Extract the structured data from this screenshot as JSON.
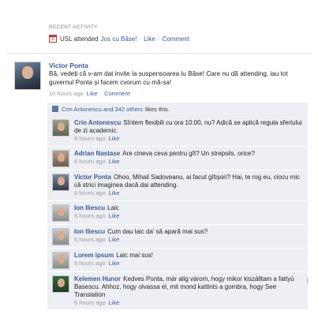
{
  "recent_activity": {
    "header": "RECENT ACTIVITY",
    "text": "USL attended",
    "event": "Jos cu Băse!",
    "like": "Like",
    "comment": "Comment"
  },
  "post": {
    "author": "Victor Ponta",
    "text": "Bă, vedeți că v-am dat invite la suspensoarea lu Băse! Care nu dă attending, iau tot guvernul Ponta și facem cvorum cu mă-sa!",
    "time": "10 hours ago",
    "like": "Like",
    "comment": "Comment"
  },
  "likes": {
    "names": "Crin Antonescu and 342 others",
    "suffix": "likes this."
  },
  "comments": [
    {
      "author": "Crin Antonescu",
      "text": "Sîntem flexibili cu ora 10:00, nu? Adică se aplică regula sfertului de zi academic.",
      "time": "8 hours ago",
      "like": "Like"
    },
    {
      "author": "Adrian Nastase",
      "text": "Are cineva ceva pentru gît? Un strepsils, orice?",
      "time": "6 hours ago",
      "like": "Like"
    },
    {
      "author": "Victor Ponta",
      "text": "Ohoo, Mihail Sadoveanu, ai facut gîtișori? Hai, te rog eu, ciocu mic că strici imaginea dacă dai attending.",
      "time": "6 hours ago",
      "like": "Like"
    },
    {
      "author": "Ion Iliescu",
      "text": "Laic",
      "time": "6 hours ago",
      "like": "Like"
    },
    {
      "author": "Ion Iliescu",
      "text": "Cum dau laic da' să apară mai sus?",
      "time": "6 hours ago",
      "like": "Like"
    },
    {
      "author": "Lorem ipsum",
      "text": "Laic mai sus!",
      "time": "6 hours ago",
      "like": "Like"
    },
    {
      "author": "Kelemen Hunor",
      "text": "Kedves Ponta, már alig várom, hogy mikor kiszálltam a fattyú Basescu. Ahhoz, hogy olvassa el, mit mond kattints a gombra, hogy See Translation",
      "time": "6 hours ago",
      "like": "Like"
    }
  ]
}
